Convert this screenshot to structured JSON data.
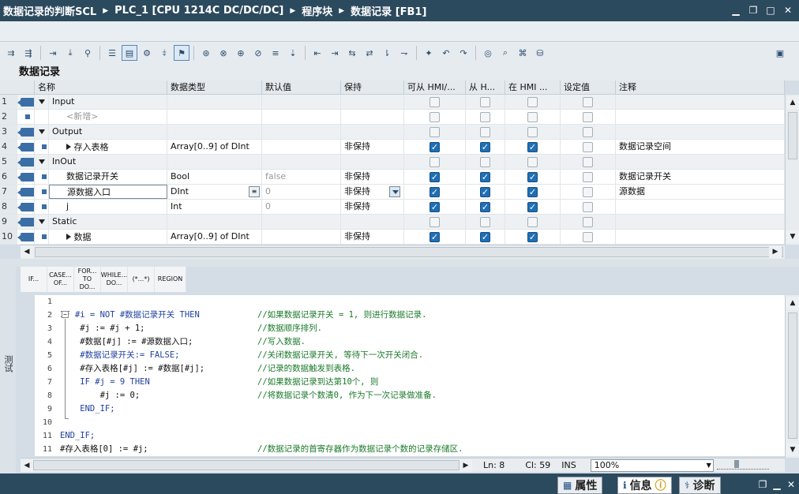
{
  "titlebar": {
    "crumbs": [
      "数据记录的判断SCL",
      "PLC_1 [CPU 1214C DC/DC/DC]",
      "程序块",
      "数据记录 [FB1]"
    ]
  },
  "block_title": "数据记录",
  "grid": {
    "headers": [
      "名称",
      "数据类型",
      "默认值",
      "保持",
      "可从 HMI/...",
      "从 H...",
      "在 HMI ...",
      "设定值",
      "注释"
    ],
    "rows": [
      {
        "num": "1",
        "name": "Input",
        "type": "",
        "default": "",
        "retain": "",
        "hmi1": false,
        "hmi2": false,
        "hmi3": false,
        "setpoint": false,
        "comment": "",
        "section": true
      },
      {
        "num": "2",
        "name": "<新增>",
        "type": "",
        "default": "",
        "retain": "",
        "hmi1": false,
        "hmi2": false,
        "hmi3": false,
        "setpoint": false,
        "comment": "",
        "section": false
      },
      {
        "num": "3",
        "name": "Output",
        "type": "",
        "default": "",
        "retain": "",
        "hmi1": false,
        "hmi2": false,
        "hmi3": false,
        "setpoint": false,
        "comment": "",
        "section": true
      },
      {
        "num": "4",
        "name": "存入表格",
        "type": "Array[0..9] of DInt",
        "default": "",
        "retain": "非保持",
        "hmi1": true,
        "hmi2": true,
        "hmi3": true,
        "setpoint": false,
        "comment": "数据记录空间",
        "section": false
      },
      {
        "num": "5",
        "name": "InOut",
        "type": "",
        "default": "",
        "retain": "",
        "hmi1": false,
        "hmi2": false,
        "hmi3": false,
        "setpoint": false,
        "comment": "",
        "section": true
      },
      {
        "num": "6",
        "name": "数据记录开关",
        "type": "Bool",
        "default": "false",
        "retain": "非保持",
        "hmi1": true,
        "hmi2": true,
        "hmi3": true,
        "setpoint": false,
        "comment": "数据记录开关",
        "section": false
      },
      {
        "num": "7",
        "name": "源数据入口",
        "type": "DInt",
        "default": "0",
        "retain": "非保持",
        "hmi1": true,
        "hmi2": true,
        "hmi3": true,
        "setpoint": false,
        "comment": "源数据",
        "section": false
      },
      {
        "num": "8",
        "name": "j",
        "type": "Int",
        "default": "0",
        "retain": "非保持",
        "hmi1": true,
        "hmi2": true,
        "hmi3": true,
        "setpoint": false,
        "comment": "",
        "section": false
      },
      {
        "num": "9",
        "name": "Static",
        "type": "",
        "default": "",
        "retain": "",
        "hmi1": false,
        "hmi2": false,
        "hmi3": false,
        "setpoint": false,
        "comment": "",
        "section": true
      },
      {
        "num": "10",
        "name": "数据",
        "type": "Array[0..9] of DInt",
        "default": "",
        "retain": "非保持",
        "hmi1": true,
        "hmi2": true,
        "hmi3": true,
        "setpoint": false,
        "comment": "",
        "section": false
      }
    ]
  },
  "snippets": [
    "IF...",
    "CASE...\nOF...",
    "FOR...\nTO DO...",
    "WHILE...\nDO...",
    "(*...*)",
    "REGION"
  ],
  "side_tab": "测试",
  "code": {
    "lines": [
      {
        "n": "1",
        "code": "",
        "comment": ""
      },
      {
        "n": "2",
        "code": "IF #i = NOT #数据记录开关 THEN",
        "comment": "//如果数据记录开关 = 1, 则进行数据记录."
      },
      {
        "n": "3",
        "code": "    #j := #j + 1;",
        "comment": "//数据顺序排列."
      },
      {
        "n": "4",
        "code": "    #数据[#j] := #源数据入口;",
        "comment": "//写入数据."
      },
      {
        "n": "5",
        "code": "    #数据记录开关:= FALSE;",
        "comment": "//关闭数据记录开关, 等待下一次开关闭合."
      },
      {
        "n": "6",
        "code": "    #存入表格[#j] := #数据[#j];",
        "comment": "//记录的数据触发到表格."
      },
      {
        "n": "7",
        "code": "    IF #j = 9 THEN",
        "comment": "//如果数据记录到达第10个, 则"
      },
      {
        "n": "8",
        "code": "        #j := 0;",
        "comment": "//将数据记录个数清0, 作为下一次记录做准备."
      },
      {
        "n": "9",
        "code": "    END_IF;",
        "comment": ""
      },
      {
        "n": "10",
        "code": "",
        "comment": ""
      },
      {
        "n": "11",
        "code": "END_IF;",
        "comment": ""
      },
      {
        "n": "11",
        "code": "#存入表格[0] := #j;",
        "comment": "//数据记录的首寄存器作为数据记录个数的记录存储区."
      },
      {
        "n": "12",
        "code": "",
        "comment": ""
      }
    ]
  },
  "status": {
    "ln": "Ln: 8",
    "cl": "Cl: 59",
    "ins": "INS",
    "zoom": "100%"
  },
  "bottom_tabs": {
    "properties": "属性",
    "info": "信息",
    "diagnostics": "诊断"
  }
}
